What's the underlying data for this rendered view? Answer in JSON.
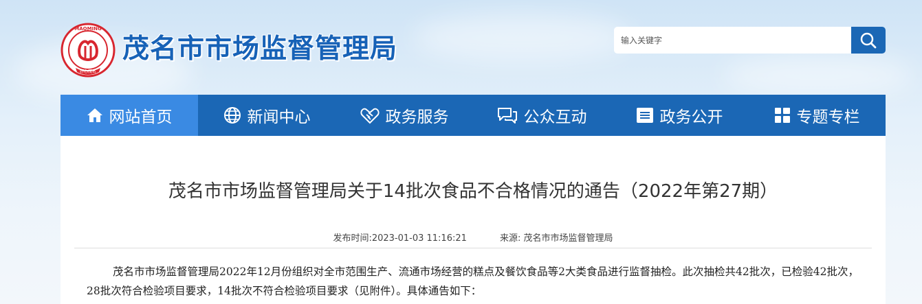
{
  "site": {
    "title": "茂名市市场监督管理局",
    "logo_ring_text": "MAOMING",
    "logo_bottom_text": "好心茂名"
  },
  "search": {
    "placeholder": "输入关键字",
    "icon": "search-icon"
  },
  "nav": {
    "items": [
      {
        "label": "网站首页",
        "icon": "home-icon",
        "active": true
      },
      {
        "label": "新闻中心",
        "icon": "globe-icon",
        "active": false
      },
      {
        "label": "政务服务",
        "icon": "handshake-icon",
        "active": false
      },
      {
        "label": "公众互动",
        "icon": "chat-icon",
        "active": false
      },
      {
        "label": "政务公开",
        "icon": "list-icon",
        "active": false
      },
      {
        "label": "专题专栏",
        "icon": "grid-icon",
        "active": false
      }
    ]
  },
  "article": {
    "title": "茂名市市场监督管理局关于14批次食品不合格情况的通告（2022年第27期）",
    "publish_time": "发布时间:2023-01-03 11:16:21",
    "source": "来源:  茂名市市场监督管理局",
    "body": "茂名市市场监督管理局2022年12月份组织对全市范围生产、流通市场经营的糕点及餐饮食品等2大类食品进行监督抽检。此次抽检共42批次，已检验42批次，28批次符合检验项目要求，14批次不符合检验项目要求（见附件）。具体通告如下："
  },
  "colors": {
    "nav_bg": "#1b67b5",
    "nav_active": "#3a8ae3",
    "title_blue": "#1762b7",
    "logo_red": "#d8262f"
  }
}
